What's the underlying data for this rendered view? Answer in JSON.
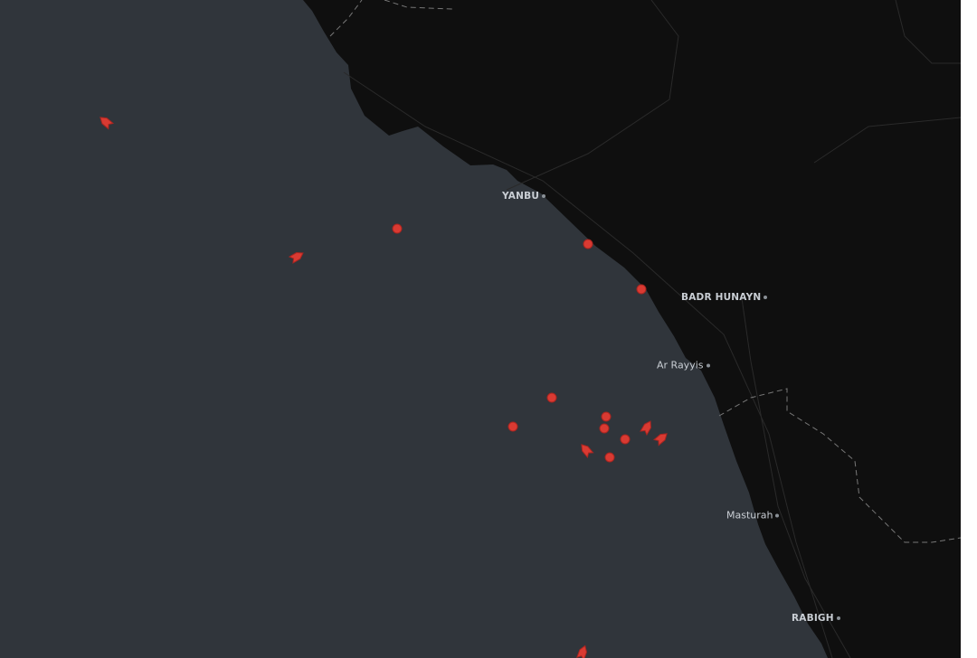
{
  "map": {
    "colors": {
      "sea": "#30353b",
      "land": "#0f0f0f",
      "marker": "#d93a32",
      "marker_outline": "#a82520",
      "label": "#c9ced4"
    },
    "places": [
      {
        "name": "YANBU",
        "style": "city"
      },
      {
        "name": "BADR HUNAYN",
        "style": "city"
      },
      {
        "name": "Ar Rayyis",
        "style": "town"
      },
      {
        "name": "Masturah",
        "style": "town"
      },
      {
        "name": "RABIGH",
        "style": "city"
      }
    ],
    "vessel_markers": {
      "stationary_dots": 9,
      "moving_vessels": 6
    }
  }
}
